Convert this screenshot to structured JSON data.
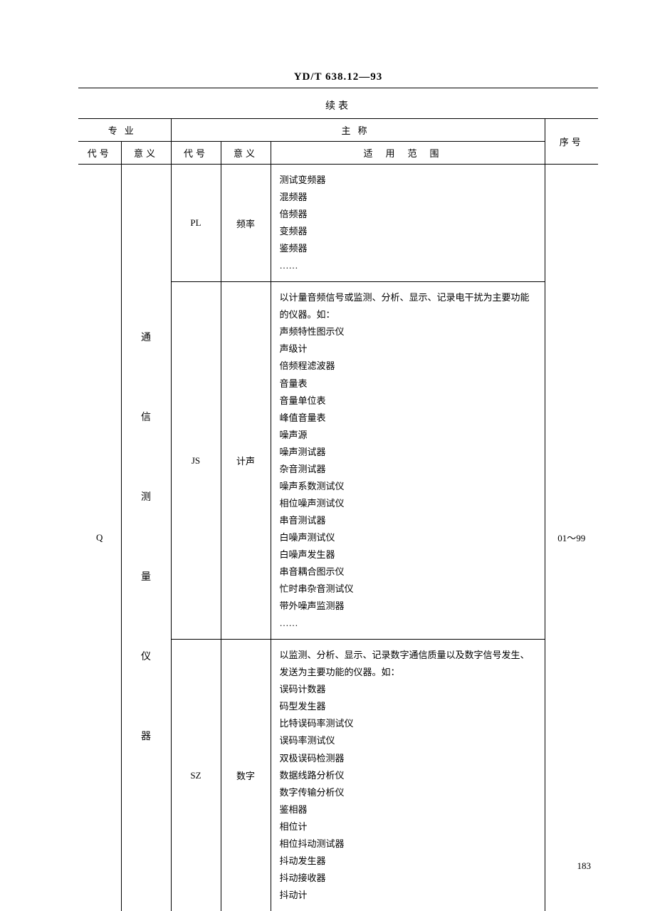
{
  "header": "YD/T 638.12—93",
  "continuation_label": "续表",
  "table_headers": {
    "specialty": "专业",
    "main_name": "主称",
    "sequence": "序号",
    "code": "代号",
    "meaning": "意义",
    "scope": "适用范围"
  },
  "specialty_code": "Q",
  "specialty_meaning": "通信测量仪器",
  "sequence_range": "01～99",
  "rows": [
    {
      "code": "PL",
      "meaning": "频率",
      "scope_lines": [
        "测试变频器",
        "混频器",
        "倍频器",
        "变频器",
        "鉴频器",
        "……"
      ]
    },
    {
      "code": "JS",
      "meaning": "计声",
      "scope_lines": [
        "以计量音频信号或监测、分析、显示、记录电干扰为主要功能的仪器。如：",
        "声频特性图示仪",
        "声级计",
        "倍频程滤波器",
        "音量表",
        "音量单位表",
        "峰值音量表",
        "噪声源",
        "噪声测试器",
        "杂音测试器",
        "噪声系数测试仪",
        "相位噪声测试仪",
        "串音测试器",
        "白噪声测试仪",
        "白噪声发生器",
        "串音耦合图示仪",
        "忙时串杂音测试仪",
        "带外噪声监测器",
        "……"
      ]
    },
    {
      "code": "SZ",
      "meaning": "数字",
      "scope_lines": [
        "以监测、分析、显示、记录数字通信质量以及数字信号发生、发送为主要功能的仪器。如：",
        "误码计数器",
        "码型发生器",
        "比特误码率测试仪",
        "误码率测试仪",
        "双极误码检测器",
        "数据线路分析仪",
        "数字传输分析仪",
        "鉴相器",
        "相位计",
        "相位抖动测试器",
        "抖动发生器",
        "抖动接收器",
        "抖动计"
      ]
    }
  ],
  "page_number": "183"
}
